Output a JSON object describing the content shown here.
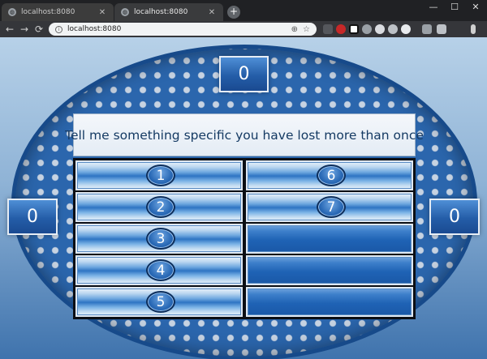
{
  "browser": {
    "tabs": [
      {
        "title": "localhost:8080",
        "active": false
      },
      {
        "title": "localhost:8080",
        "active": true
      }
    ],
    "address": "localhost:8080",
    "new_tab_glyph": "+",
    "nav": {
      "back": "←",
      "forward": "→",
      "reload": "⟳"
    },
    "window_controls": {
      "minimize": "—",
      "maximize": "☐",
      "close": "✕"
    },
    "tab_close_glyph": "✕",
    "extension_icons": [
      "extension-icon",
      "lastpass-icon",
      "box-icon",
      "settings-icon",
      "camera-icon",
      "record-icon",
      "ad-block-icon",
      "playlist-icon",
      "cast-icon",
      "menu-icon"
    ]
  },
  "game": {
    "scores": {
      "top": "0",
      "left": "0",
      "right": "0"
    },
    "question": "Tell me something specific you have lost more than once",
    "answers": [
      {
        "number": "1",
        "revealed": false
      },
      {
        "number": "2",
        "revealed": false
      },
      {
        "number": "3",
        "revealed": false
      },
      {
        "number": "4",
        "revealed": false
      },
      {
        "number": "5",
        "revealed": false
      },
      {
        "number": "6",
        "revealed": false
      },
      {
        "number": "7",
        "revealed": false
      },
      {
        "number": "",
        "revealed": false
      },
      {
        "number": "",
        "revealed": false
      },
      {
        "number": "",
        "revealed": false
      }
    ],
    "colors": {
      "board_blue": "#2b66ad",
      "score_blue": "#245da8",
      "question_text": "#153a63"
    }
  }
}
